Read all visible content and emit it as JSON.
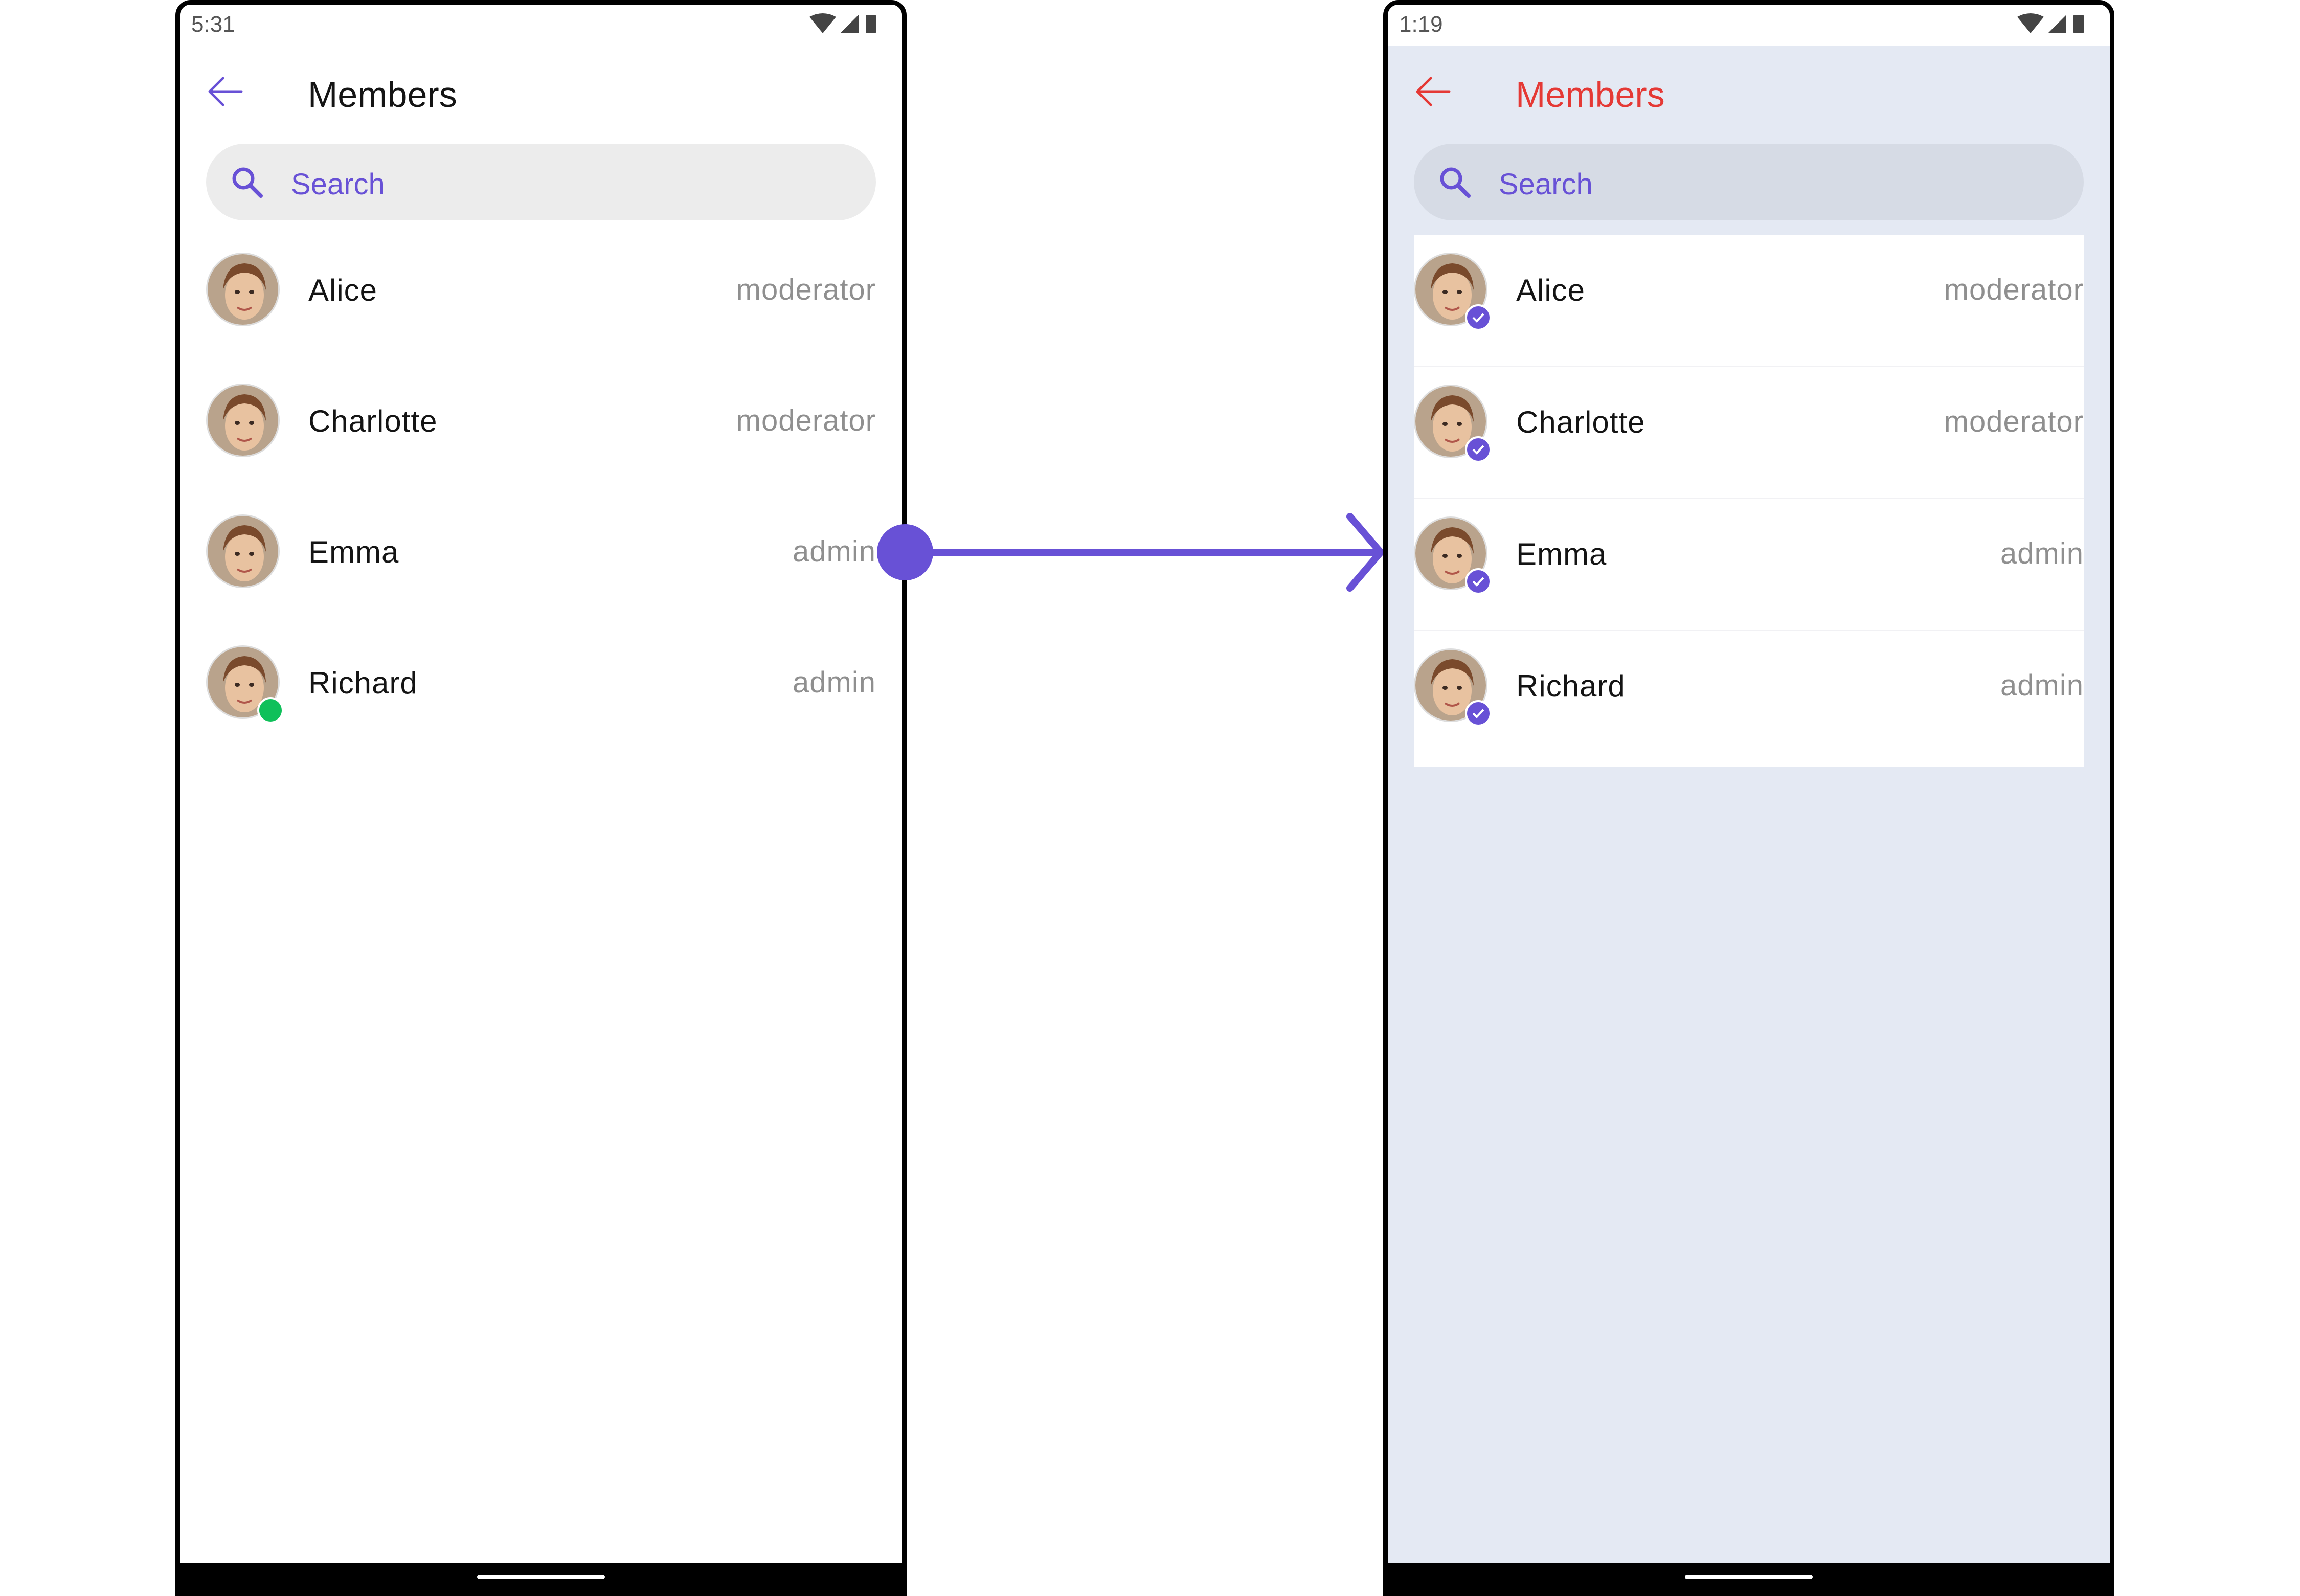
{
  "left_screen": {
    "status_time": "5:31",
    "title": "Members",
    "search_placeholder": "Search",
    "members": [
      {
        "name": "Alice",
        "role": "moderator"
      },
      {
        "name": "Charlotte",
        "role": "moderator"
      },
      {
        "name": "Emma",
        "role": "admin"
      },
      {
        "name": "Richard",
        "role": "admin"
      }
    ]
  },
  "right_screen": {
    "status_time": "1:19",
    "title": "Members",
    "search_placeholder": "Search",
    "members": [
      {
        "name": "Alice",
        "role": "moderator"
      },
      {
        "name": "Charlotte",
        "role": "moderator"
      },
      {
        "name": "Emma",
        "role": "admin"
      },
      {
        "name": "Richard",
        "role": "admin"
      }
    ]
  },
  "colors": {
    "accent": "#6851d6",
    "custom_title": "#e53935",
    "custom_background": "#e4e9f3",
    "online": "#0fc05a"
  }
}
